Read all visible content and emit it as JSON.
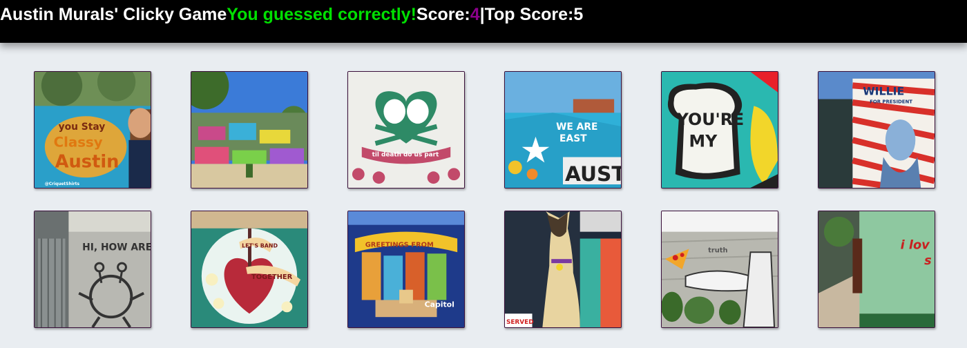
{
  "header": {
    "brand": "Austin Murals' Clicky Game",
    "message": "You guessed correctly!",
    "score_label": "Score: ",
    "score_value": "4",
    "separator": " | ",
    "top_label": "Top Score: ",
    "top_value": "5",
    "colors": {
      "message": "#00e000",
      "score_value": "#8b008b"
    }
  },
  "murals": [
    {
      "icon": "you-stay-classy-austin-mural",
      "text1": "you Stay",
      "text2": "Classy",
      "text3": "Austin",
      "caption": "@CriquetShirts"
    },
    {
      "icon": "hope-graffiti-park-mural"
    },
    {
      "icon": "til-death-do-us-part-mural",
      "text1": "til death do us part"
    },
    {
      "icon": "we-are-east-austin-mural",
      "text1": "WE ARE",
      "text2": "EAST",
      "text3": "AUST"
    },
    {
      "icon": "youre-my-butter-half-mural",
      "text1": "YOU'RE",
      "text2": "MY"
    },
    {
      "icon": "willie-for-president-mural",
      "text1": "WILLIE",
      "text2": "FOR PRESIDENT"
    },
    {
      "icon": "hi-how-are-you-mural",
      "text1": "HI, HOW ARE"
    },
    {
      "icon": "lets-band-together-mural",
      "text1": "LET'S BAND",
      "text2": "TOGETHER"
    },
    {
      "icon": "greetings-from-austin-mural",
      "text1": "GREETINGS FROM",
      "text2": "Capitol"
    },
    {
      "icon": "siamese-cat-mural",
      "text1": "SERVED"
    },
    {
      "icon": "truth-pizza-mural",
      "text1": "truth"
    },
    {
      "icon": "i-love-you-so-mural",
      "text1": "i lov",
      "text2": "s"
    }
  ]
}
